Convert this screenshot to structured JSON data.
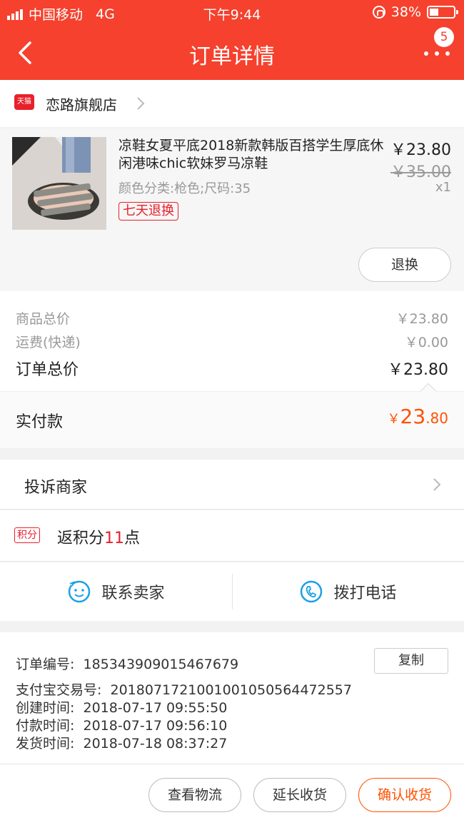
{
  "status_bar": {
    "carrier": "中国移动",
    "network": "4G",
    "time": "下午9:44",
    "battery": "38%"
  },
  "nav": {
    "title": "订单详情",
    "badge": "5"
  },
  "store": {
    "logo_text": "天猫",
    "name": "恋路旗舰店"
  },
  "product": {
    "title": "凉鞋女夏平底2018新款韩版百搭学生厚底休闲港味chic软妹罗马凉鞋",
    "sku": "颜色分类:枪色;尺码:35",
    "tag": "七天退换",
    "price": "￥23.80",
    "original_price": "￥35.00",
    "quantity": "x1",
    "return_button": "退换"
  },
  "summary": {
    "goods_label": "商品总价",
    "goods_value": "￥23.80",
    "shipping_label": "运费(快递)",
    "shipping_value": "￥0.00",
    "total_label": "订单总价",
    "total_value": "￥23.80",
    "paid_label": "实付款",
    "paid_currency": "￥",
    "paid_int": "23",
    "paid_dec": ".80"
  },
  "complain": {
    "label": "投诉商家"
  },
  "points": {
    "icon_text": "积分",
    "prefix": "返积分",
    "value": "11",
    "suffix": "点"
  },
  "contact": {
    "seller_label": "联系卖家",
    "phone_label": "拨打电话"
  },
  "order_info": {
    "order_no_label": "订单编号:",
    "order_no": "185343909015467679",
    "copy_button": "复制",
    "alipay_label": "支付宝交易号:",
    "alipay_no": "2018071721001001050564472557",
    "created_label": "创建时间:",
    "created": "2018-07-17 09:55:50",
    "paid_label": "付款时间:",
    "paid": "2018-07-17 09:56:10",
    "shipped_label": "发货时间:",
    "shipped": "2018-07-18 08:37:27"
  },
  "actions": {
    "logistics": "查看物流",
    "extend": "延长收货",
    "confirm": "确认收货"
  },
  "colors": {
    "brand": "#f5412d",
    "accent": "#ff5000",
    "tmall_red": "#e8202c",
    "contact_blue": "#1aa0e8"
  }
}
